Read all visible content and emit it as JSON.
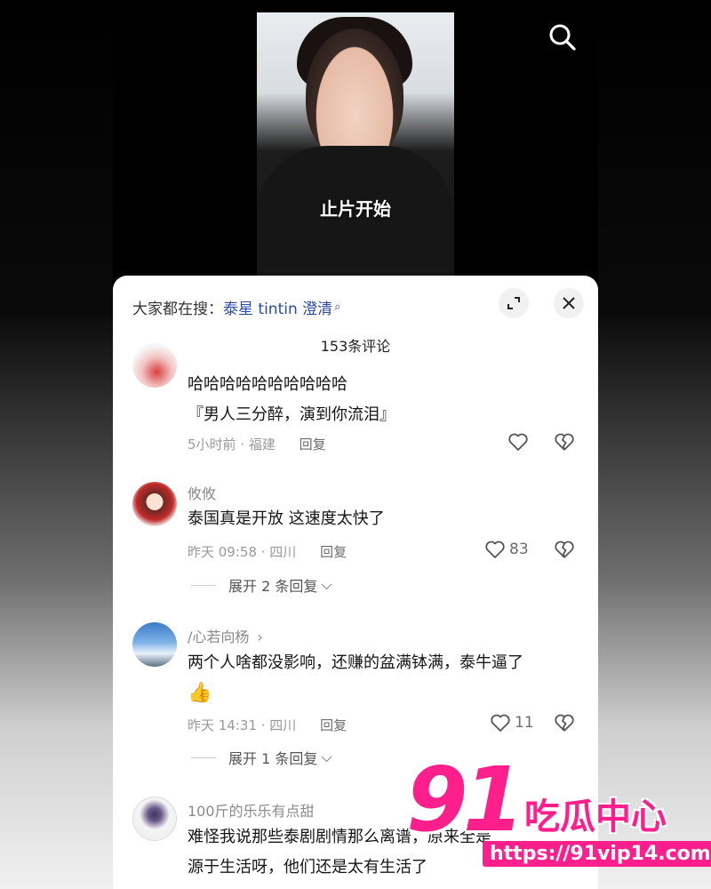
{
  "video": {
    "caption": "止片开始"
  },
  "sheet": {
    "hot_search_label": "大家都在搜：",
    "hot_search_term": "泰星 tintin 澄清",
    "hot_search_icon": "search-small-icon",
    "comment_count": "153条评论"
  },
  "comments": [
    {
      "user": "",
      "text_line1": "哈哈哈哈哈哈哈哈哈哈",
      "text_line2": "『男人三分醉，演到你流泪』",
      "meta": "5小时前 · 福建",
      "reply": "回复",
      "likes": ""
    },
    {
      "user": "攸攸",
      "text_line1": "泰国真是开放 这速度太快了",
      "text_line2": "",
      "meta": "昨天 09:58 · 四川",
      "reply": "回复",
      "likes": "83",
      "expand": "展开 2 条回复"
    },
    {
      "user": "/心若向杨",
      "text_line1": "两个人啥都没影响，还赚的盆满钵满，泰牛逼了",
      "text_line2": "👍",
      "meta": "昨天 14:31 · 四川",
      "reply": "回复",
      "likes": "11",
      "expand": "展开 1 条回复"
    },
    {
      "user": "100斤的乐乐有点甜",
      "text_line1": "难怪我说那些泰剧剧情那么离谱，原来全是",
      "text_line2": "源于生活呀，他们还是太有生活了",
      "meta": "",
      "reply": "",
      "likes": ""
    }
  ],
  "watermark": {
    "logo": "91",
    "name": "吃瓜中心",
    "url": "https://91vip14.com"
  },
  "colors": {
    "accent_link": "#2a4aa8",
    "watermark_pink": "#ff1f8c"
  }
}
